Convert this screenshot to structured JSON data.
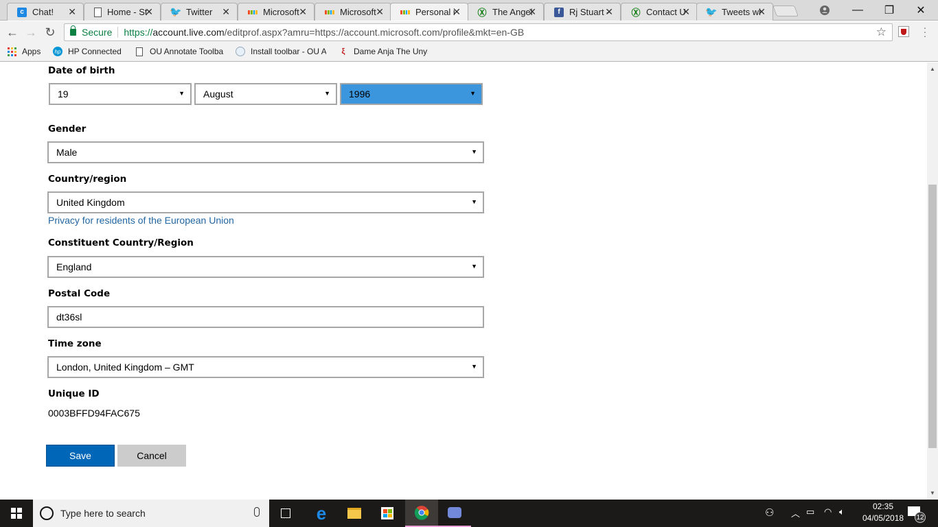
{
  "browser": {
    "tabs": [
      {
        "title": "Chat!",
        "icon": "chat-c-icon",
        "active": false
      },
      {
        "title": "Home - St",
        "icon": "page-icon",
        "active": false
      },
      {
        "title": "Twitter",
        "icon": "twitter-icon",
        "active": false
      },
      {
        "title": "Microsoft",
        "icon": "microsoft-icon",
        "active": false
      },
      {
        "title": "Microsoft",
        "icon": "microsoft-icon",
        "active": false
      },
      {
        "title": "Personal i",
        "icon": "microsoft-icon",
        "active": true
      },
      {
        "title": "The Angel",
        "icon": "xbox-icon",
        "active": false
      },
      {
        "title": "Rj Stuart -",
        "icon": "facebook-icon",
        "active": false
      },
      {
        "title": "Contact U",
        "icon": "xbox-icon",
        "active": false
      },
      {
        "title": "Tweets wi",
        "icon": "twitter-icon",
        "active": false
      }
    ],
    "close_glyph": "✕",
    "secure_label": "Secure",
    "url_prefix": "https://",
    "url_host": "account.live.com",
    "url_path": "/editprof.aspx?amru=https://account.microsoft.com/profile&mkt=en-GB",
    "bookmarks": [
      {
        "label": "Apps",
        "icon": "apps-grid-icon"
      },
      {
        "label": "HP Connected",
        "icon": "hp-icon"
      },
      {
        "label": "OU Annotate Toolba",
        "icon": "page-icon"
      },
      {
        "label": "Install toolbar - OU A",
        "icon": "shield-icon"
      },
      {
        "label": "Dame Anja The Unyi",
        "icon": "dragon-icon"
      }
    ]
  },
  "form": {
    "dob": {
      "label": "Date of birth",
      "day": "19",
      "month": "August",
      "year": "1996"
    },
    "gender": {
      "label": "Gender",
      "value": "Male"
    },
    "country": {
      "label": "Country/region",
      "value": "United Kingdom"
    },
    "privacy_link": "Privacy for residents of the European Union",
    "constituent": {
      "label": "Constituent Country/Region",
      "value": "England"
    },
    "postal": {
      "label": "Postal Code",
      "value": "dt36sl"
    },
    "timezone": {
      "label": "Time zone",
      "value": "London, United Kingdom – GMT"
    },
    "unique_id": {
      "label": "Unique ID",
      "value": "0003BFFD94FAC675"
    },
    "save_label": "Save",
    "cancel_label": "Cancel",
    "dropdown_glyph": "▼"
  },
  "colors": {
    "accent": "#0067b8",
    "highlight": "#3b96dd",
    "link": "#2266a3"
  },
  "taskbar": {
    "search_placeholder": "Type here to search",
    "time": "02:35",
    "date": "04/05/2018",
    "notification_count": "12"
  }
}
